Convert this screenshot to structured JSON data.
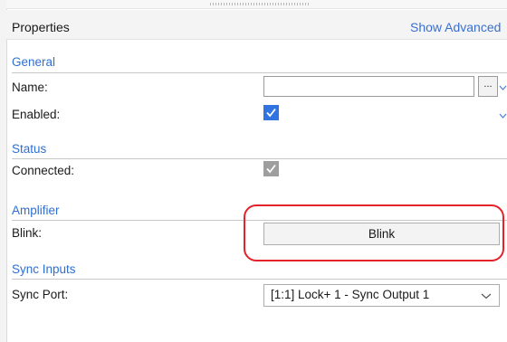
{
  "panel": {
    "title": "Properties",
    "show_advanced": "Show Advanced"
  },
  "sections": {
    "general": "General",
    "status": "Status",
    "amplifier": "Amplifier",
    "sync_inputs": "Sync Inputs"
  },
  "fields": {
    "name_label": "Name:",
    "name_value": "",
    "browse_label": "...",
    "enabled_label": "Enabled:",
    "enabled_checked": true,
    "connected_label": "Connected:",
    "connected_checked": true,
    "blink_label": "Blink:",
    "blink_button": "Blink",
    "sync_port_label": "Sync Port:",
    "sync_port_value": "[1:1] Lock+ 1 - Sync Output 1"
  },
  "colors": {
    "accent": "#2f6fd2",
    "checkbox_enabled": "#2f74e0",
    "checkbox_disabled": "#9e9e9e",
    "highlight": "#e3222a"
  },
  "icons": {
    "check": "check-icon",
    "dropdown": "chevron-down-icon"
  }
}
